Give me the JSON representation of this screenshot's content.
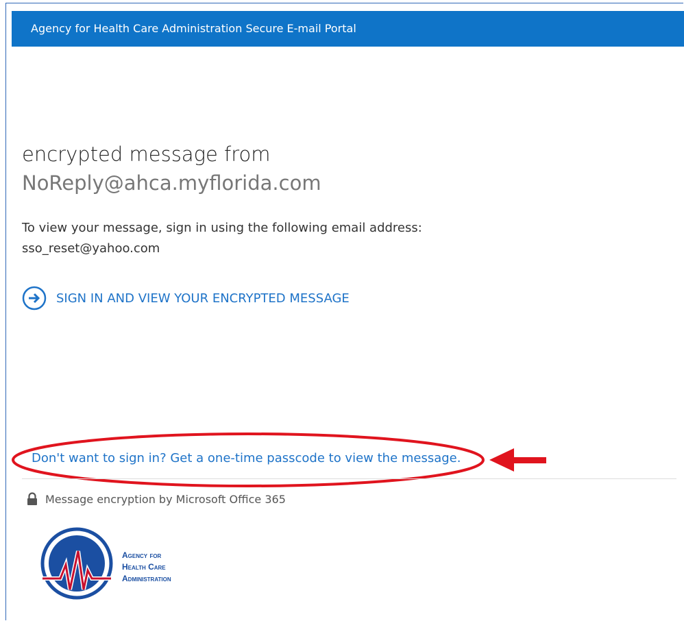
{
  "header": {
    "title": "Agency for Health Care Administration Secure E-mail Portal"
  },
  "message": {
    "title": "encrypted message from",
    "sender": "NoReply@ahca.myflorida.com",
    "instructions": "To view your message, sign in using the following email address:",
    "recipient": "sso_reset@yahoo.com"
  },
  "actions": {
    "signin_label": "SIGN IN AND VIEW YOUR ENCRYPTED MESSAGE",
    "otp_label": "Don't want to sign in? Get a one-time passcode to view the message."
  },
  "footer": {
    "encryption_text": "Message encryption by Microsoft Office 365"
  },
  "logo": {
    "line1": "Agency for",
    "line2": "Health Care",
    "line3": "Administration"
  },
  "colors": {
    "header_bg": "#0f74c8",
    "link": "#1e73c8",
    "annotation": "#e0141e",
    "logo_blue": "#1b4fa2",
    "logo_red": "#c8102e"
  }
}
